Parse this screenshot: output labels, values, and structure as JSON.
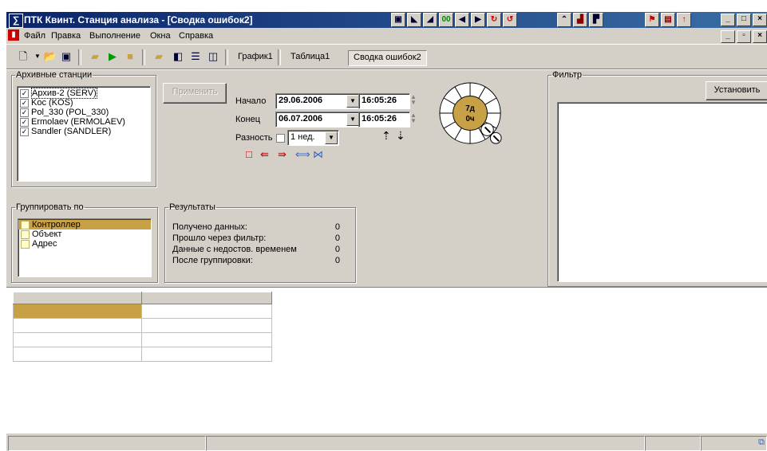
{
  "window": {
    "title": "ПТК Квинт. Станция анализа - [Сводка ошибок2]",
    "app_icon": "sigma-icon",
    "title_toolbar_icons": [
      "station-icon",
      "arrow-icon",
      "arrow-icon",
      "counter-icon",
      "arrow-left-icon",
      "arrow-right-icon",
      "refresh-icon",
      "refresh-icon",
      "chart-icon",
      "graph-icon",
      "graph-icon",
      "flag-icon",
      "table-icon",
      "up-icon"
    ],
    "accent": "#0a246a"
  },
  "menu": {
    "items": [
      "Файл",
      "Правка",
      "Выполнение",
      "Окна",
      "Справка"
    ]
  },
  "toolbar": {
    "tabs": [
      "График1",
      "Таблица1",
      "Сводка ошибок2"
    ],
    "active_tab": "Сводка ошибок2"
  },
  "archive": {
    "legend": "Архивные станции",
    "stations": [
      {
        "label": "Архив-2 (SERV)",
        "checked": true
      },
      {
        "label": "Koc (KOS)",
        "checked": true
      },
      {
        "label": "Pol_330 (POL_330)",
        "checked": true
      },
      {
        "label": "Ermolaev (ERMOLAEV)",
        "checked": true
      },
      {
        "label": "Sandler (SANDLER)",
        "checked": true
      }
    ],
    "apply_label": "Применить"
  },
  "time": {
    "start_label": "Начало",
    "start_date": "29.06.2006",
    "start_time": "16:05:26",
    "end_label": "Конец",
    "end_date": "06.07.2006",
    "end_time": "16:05:26",
    "diff_label": "Разность",
    "diff_value": "1 нед.",
    "dial_days": "7д",
    "dial_hours": "0ч"
  },
  "group": {
    "legend": "Группировать по",
    "items": [
      "Контроллер",
      "Объект",
      "Адрес"
    ],
    "selected": "Контроллер"
  },
  "results": {
    "legend": "Результаты",
    "rows": [
      {
        "label": "Получено данных:",
        "value": "0"
      },
      {
        "label": "Прошло через фильтр:",
        "value": "0"
      },
      {
        "label": "Данные с недостов. временем",
        "value": "0"
      },
      {
        "label": "После группировки:",
        "value": "0"
      }
    ]
  },
  "filter": {
    "legend": "Фильтр",
    "set_label": "Установить"
  },
  "colors": {
    "face": "#d4d0c8",
    "selection": "#c8a046",
    "dial": "#c8a046"
  }
}
